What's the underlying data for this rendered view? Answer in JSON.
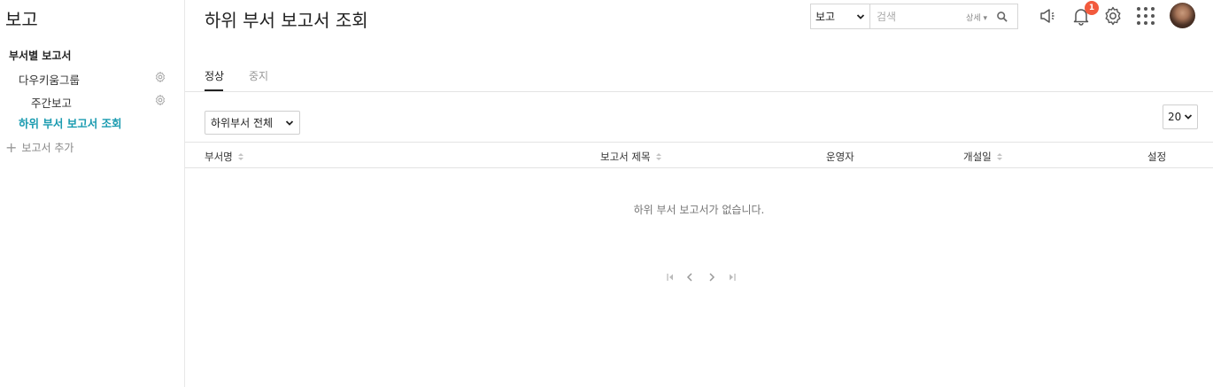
{
  "sidebar": {
    "title": "보고",
    "section_label": "부서별 보고서",
    "items": [
      {
        "label": "다우키움그룹"
      },
      {
        "label": "주간보고"
      },
      {
        "label": "하위 부서 보고서 조회"
      }
    ],
    "add_label": "보고서 추가"
  },
  "header": {
    "title": "하위 부서 보고서 조회",
    "search": {
      "scope": "보고",
      "placeholder": "검색",
      "detail_label": "상세"
    },
    "notification_count": "1"
  },
  "tabs": [
    {
      "label": "정상"
    },
    {
      "label": "중지"
    }
  ],
  "toolbar": {
    "dept_filter": "하위부서 전체",
    "page_size": "20"
  },
  "table": {
    "columns": [
      {
        "label": "부서명"
      },
      {
        "label": "보고서 제목"
      },
      {
        "label": "운영자"
      },
      {
        "label": "개설일"
      },
      {
        "label": "설정"
      }
    ],
    "empty_message": "하위 부서 보고서가 없습니다."
  },
  "colors": {
    "accent": "#1a9bb0",
    "badge": "#f25a3d"
  }
}
